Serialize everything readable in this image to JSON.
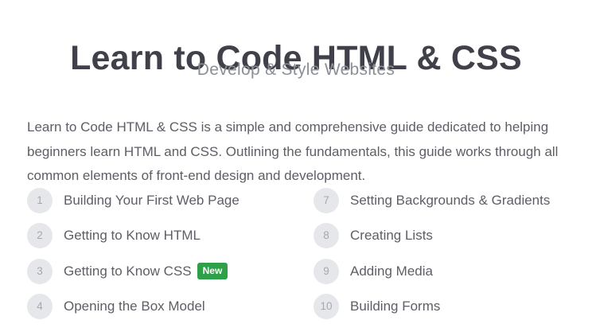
{
  "header": {
    "title": "Learn to Code HTML & CSS",
    "subtitle": "Develop & Style Websites"
  },
  "intro": {
    "text": "Learn to Code HTML & CSS is a simple and comprehensive guide dedicated to helping beginners learn HTML and CSS. Outlining the fundamentals, this guide works through all common elements of front-end design and development."
  },
  "lessons": {
    "left": [
      {
        "num": "1",
        "label": "Building Your First Web Page"
      },
      {
        "num": "2",
        "label": "Getting to Know HTML"
      },
      {
        "num": "3",
        "label": "Getting to Know CSS",
        "badge": "New"
      },
      {
        "num": "4",
        "label": "Opening the Box Model"
      }
    ],
    "right": [
      {
        "num": "7",
        "label": "Setting Backgrounds & Gradients"
      },
      {
        "num": "8",
        "label": "Creating Lists"
      },
      {
        "num": "9",
        "label": "Adding Media"
      },
      {
        "num": "10",
        "label": "Building Forms"
      }
    ]
  },
  "colors": {
    "title": "#3f4049",
    "subtitle": "#8d8f98",
    "body_text": "#5d5e66",
    "number_circle": "#e6e7ea",
    "badge_green": "#2fa04a"
  }
}
